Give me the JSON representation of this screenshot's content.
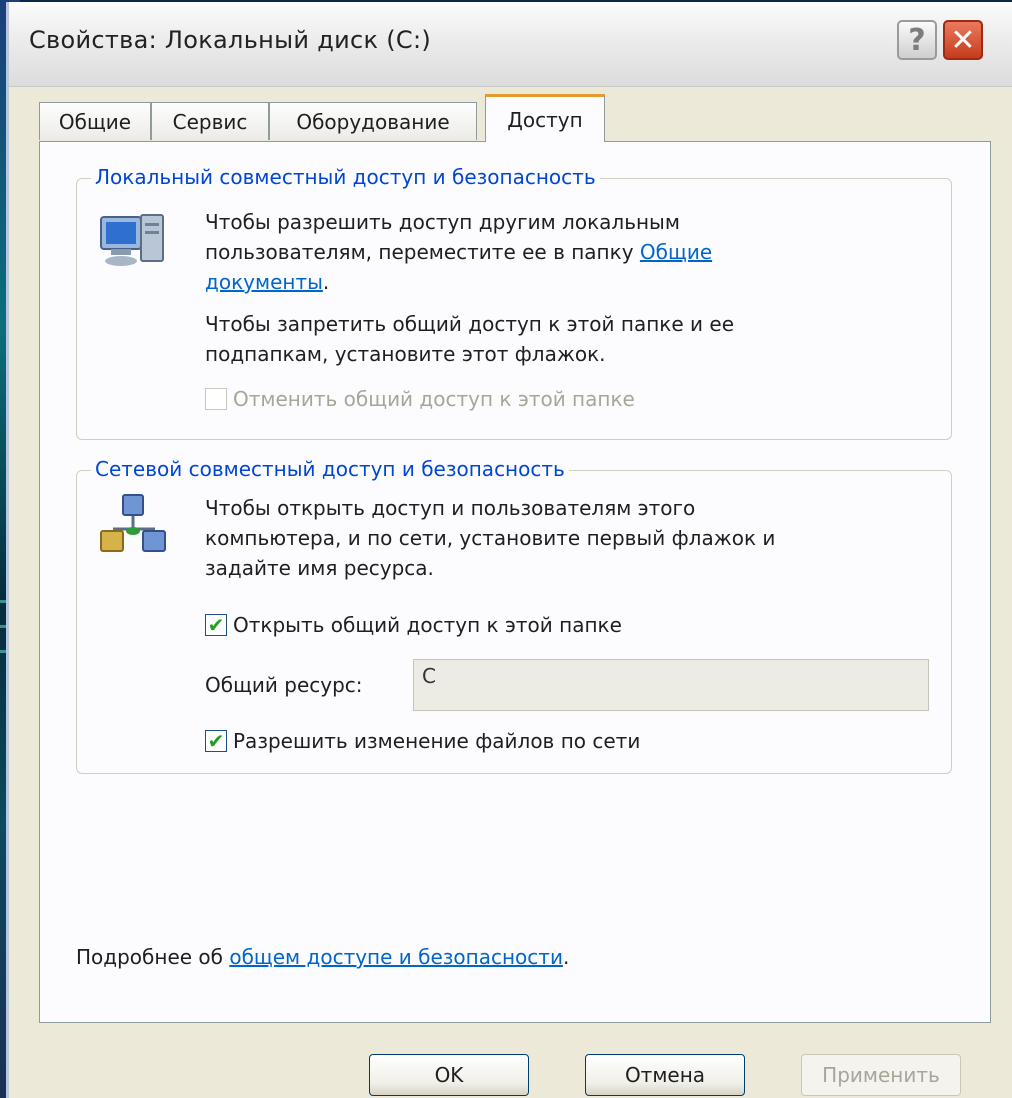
{
  "window": {
    "title": "Свойства: Локальный диск (C:)",
    "help_symbol": "?",
    "close_symbol": "✕"
  },
  "tabs": [
    {
      "label": "Общие"
    },
    {
      "label": "Сервис"
    },
    {
      "label": "Оборудование"
    },
    {
      "label": "Доступ",
      "active": true
    }
  ],
  "local_section": {
    "title": "Локальный совместный доступ и безопасность",
    "icon": "computer-icon",
    "text1_before": "Чтобы разрешить доступ другим локальным",
    "text1_line2": "пользователям, переместите ее в папку ",
    "text1_link_part1": "Общие",
    "text1_link_part2": "документы",
    "text1_end": ".",
    "text2_line1": "Чтобы запретить общий доступ к этой папке и ее",
    "text2_line2": "подпапкам, установите этот флажок.",
    "checkbox_label": "Отменить общий доступ к этой папке",
    "checkbox_checked": false,
    "checkbox_enabled": false
  },
  "network_section": {
    "title": "Сетевой совместный доступ и безопасность",
    "icon": "network-icon",
    "text_line1": "Чтобы открыть доступ и пользователям этого",
    "text_line2": "компьютера, и по сети, установите первый флажок и",
    "text_line3": "задайте имя ресурса.",
    "share_checkbox_label": "Открыть общий доступ к этой папке",
    "share_checkbox_checked": true,
    "share_name_label": "Общий ресурс:",
    "share_name_value": "C",
    "allow_checkbox_label": "Разрешить изменение файлов по сети",
    "allow_checkbox_checked": true
  },
  "more_info": {
    "prefix": "Подробнее об ",
    "link": "общем доступе и безопасности",
    "suffix": "."
  },
  "buttons": {
    "ok": "OK",
    "cancel": "Отмена",
    "apply": "Применить"
  },
  "colors": {
    "group_title": "#0046d5",
    "link": "#0066cc",
    "active_tab_accent": "#e69a2c",
    "dialog_bg": "#ece9d8",
    "panel_bg": "#fcfcfe"
  }
}
